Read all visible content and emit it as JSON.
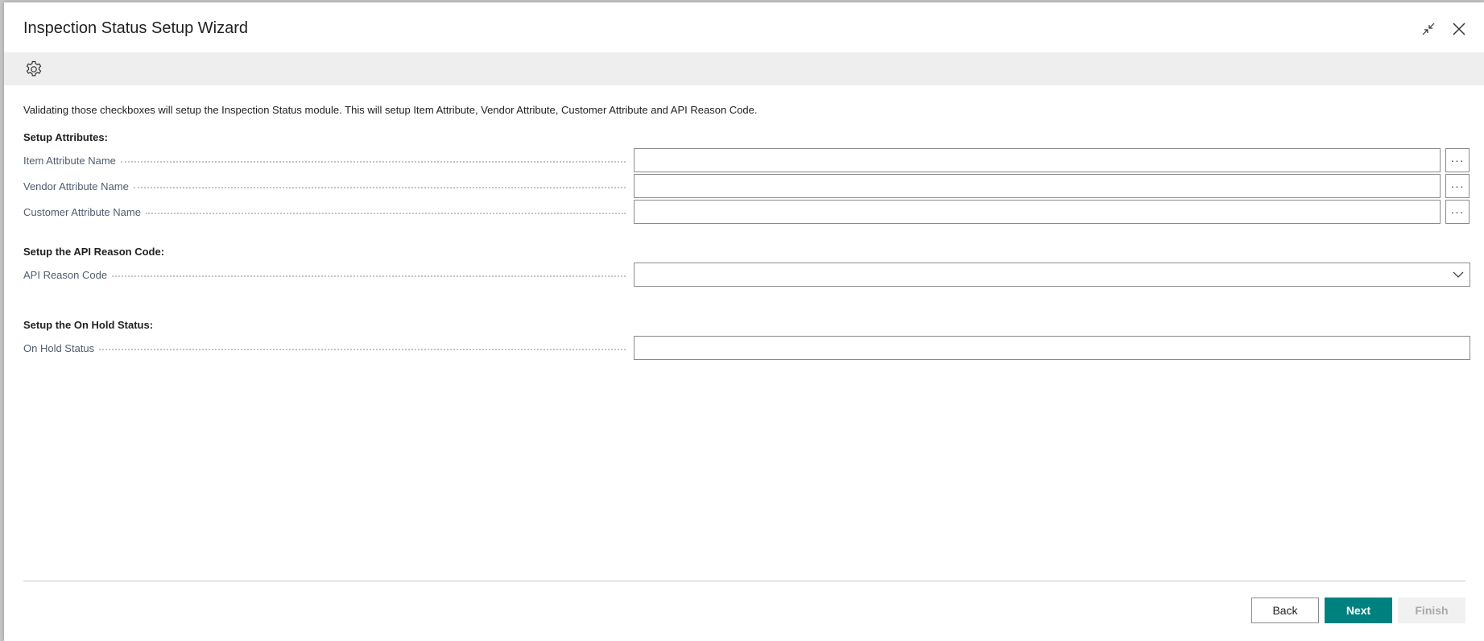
{
  "dialog": {
    "title": "Inspection Status Setup Wizard"
  },
  "icons": {
    "collapse": "collapse-arrows-icon",
    "close": "close-icon",
    "settings": "gear-icon",
    "lookup": "ellipsis-icon",
    "dropdown": "chevron-down-icon"
  },
  "intro_text": "Validating those checkboxes will setup the Inspection Status module. This will setup Item Attribute, Vendor Attribute, Customer Attribute and API Reason Code.",
  "groups": {
    "attributes": {
      "title": "Setup Attributes:",
      "fields": [
        {
          "label": "Item Attribute Name",
          "value": "",
          "lookup": "···"
        },
        {
          "label": "Vendor Attribute Name",
          "value": "",
          "lookup": "···"
        },
        {
          "label": "Customer Attribute Name",
          "value": "",
          "lookup": "···"
        }
      ]
    },
    "api": {
      "title": "Setup the API Reason Code:",
      "field": {
        "label": "API Reason Code",
        "value": ""
      }
    },
    "onhold": {
      "title": "Setup the On Hold Status:",
      "field": {
        "label": "On Hold Status",
        "value": ""
      }
    }
  },
  "footer": {
    "back_label": "Back",
    "next_label": "Next",
    "finish_label": "Finish"
  },
  "colors": {
    "primary": "#00817f",
    "disabled_bg": "#f1f1f1",
    "disabled_text": "#a9a9a9",
    "label_text": "#505c6d",
    "toolbar_bg": "#eeeeee"
  }
}
